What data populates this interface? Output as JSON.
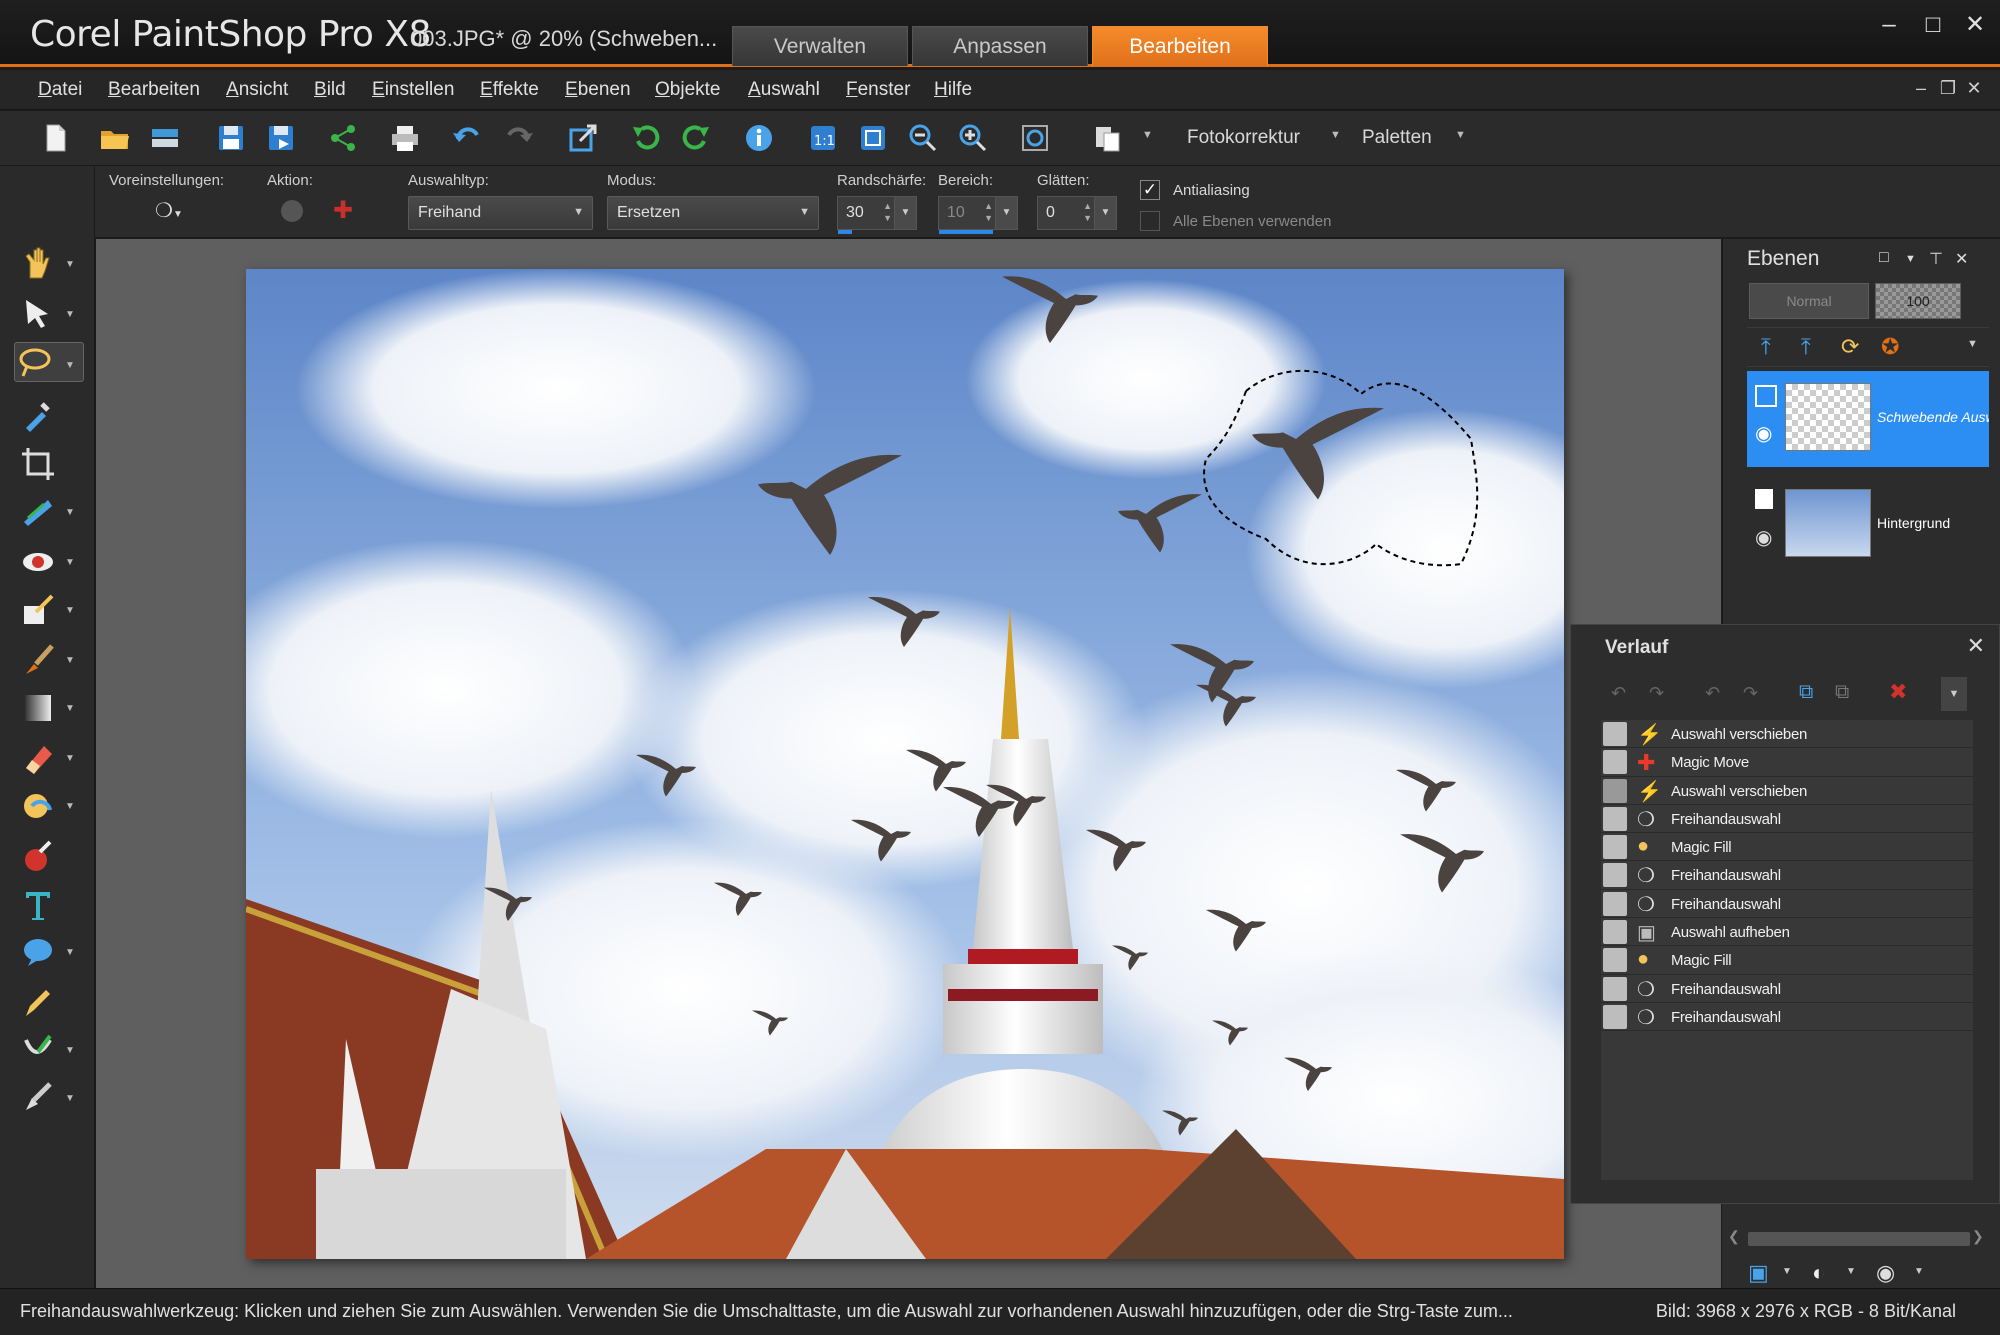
{
  "app": {
    "title": "Corel PaintShop Pro X8",
    "document_title": "003.JPG* @  20% (Schweben...",
    "workspace_tabs": [
      "Verwalten",
      "Anpassen",
      "Bearbeiten"
    ],
    "active_tab": "Bearbeiten"
  },
  "menu": [
    "Datei",
    "Bearbeiten",
    "Ansicht",
    "Bild",
    "Einstellen",
    "Effekte",
    "Ebenen",
    "Objekte",
    "Auswahl",
    "Fenster",
    "Hilfe"
  ],
  "toolbar": {
    "fotokorrektur_label": "Fotokorrektur",
    "paletten_label": "Paletten"
  },
  "options": {
    "presets_label": "Voreinstellungen:",
    "action_label": "Aktion:",
    "selection_type_label": "Auswahltyp:",
    "selection_type_value": "Freihand",
    "mode_label": "Modus:",
    "mode_value": "Ersetzen",
    "feather_label": "Randschärfe:",
    "feather_value": "30",
    "range_label": "Bereich:",
    "range_value": "10",
    "smoothing_label": "Glätten:",
    "smoothing_value": "0",
    "antialias_label": "Antialiasing",
    "antialias_checked": true,
    "all_layers_label": "Alle Ebenen verwenden",
    "all_layers_checked": false
  },
  "layers": {
    "title": "Ebenen",
    "blend_mode": "Normal",
    "opacity": "100",
    "items": [
      {
        "name": "Schwebende Auswahl",
        "active": true
      },
      {
        "name": "Hintergrund",
        "active": false
      }
    ]
  },
  "history": {
    "title": "Verlauf",
    "items": [
      {
        "label": "Auswahl verschieben",
        "icon": "lightning-icon"
      },
      {
        "label": "Magic Move",
        "icon": "move-icon"
      },
      {
        "label": "Auswahl verschieben",
        "icon": "lightning-icon"
      },
      {
        "label": "Freihandauswahl",
        "icon": "lasso-icon"
      },
      {
        "label": "Magic Fill",
        "icon": "magic-fill-icon"
      },
      {
        "label": "Freihandauswahl",
        "icon": "lasso-icon"
      },
      {
        "label": "Freihandauswahl",
        "icon": "lasso-icon"
      },
      {
        "label": "Auswahl aufheben",
        "icon": "deselect-icon"
      },
      {
        "label": "Magic Fill",
        "icon": "magic-fill-icon"
      },
      {
        "label": "Freihandauswahl",
        "icon": "lasso-icon"
      },
      {
        "label": "Freihandauswahl",
        "icon": "lasso-icon"
      }
    ]
  },
  "status": {
    "hint": "Freihandauswahlwerkzeug: Klicken und ziehen Sie zum Auswählen. Verwenden Sie die Umschalttaste, um die Auswahl zur vorhandenen Auswahl hinzuzufügen, oder die Strg-Taste zum...",
    "image_info": "Bild:  3968 x 2976 x RGB - 8 Bit/Kanal"
  },
  "colors": {
    "accent": "#e07014",
    "selection_blue": "#2c8ef2"
  }
}
